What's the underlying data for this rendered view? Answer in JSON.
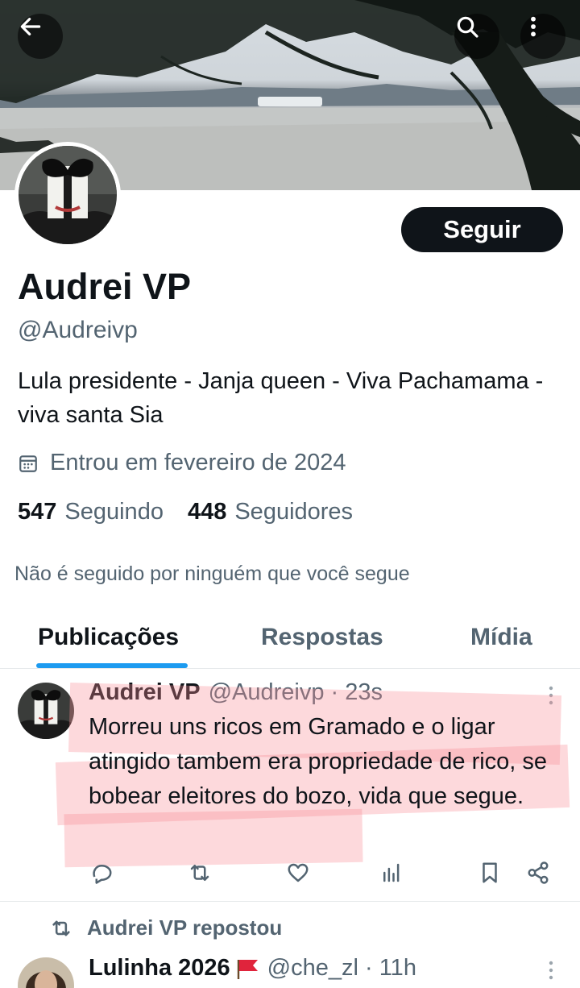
{
  "header": {
    "back_icon": "arrow-left-icon",
    "search_icon": "search-icon",
    "more_icon": "more-vertical-icon"
  },
  "profile": {
    "follow_label": "Seguir",
    "display_name": "Audrei VP",
    "handle": "@Audreivp",
    "bio": "Lula presidente - Janja queen - Viva Pachamama - viva santa Sia",
    "joined": "Entrou em fevereiro de 2024",
    "following_count": "547",
    "following_label": "Seguindo",
    "followers_count": "448",
    "followers_label": "Seguidores",
    "mutuals_note": "Não é seguido por ninguém que você segue"
  },
  "tabs": [
    {
      "label": "Publicações",
      "active": true
    },
    {
      "label": "Respostas",
      "active": false
    },
    {
      "label": "Mídia",
      "active": false
    }
  ],
  "posts": [
    {
      "name": "Audrei VP",
      "handle": "@Audreivp",
      "time": "23s",
      "meta": "@Audreivp · 23s",
      "text": "Morreu uns ricos em Gramado e o ligar atingido tambem era propriedade de rico, se bobear eleitores do bozo, vida que segue.",
      "actions": [
        "reply-icon",
        "repost-icon",
        "like-icon",
        "views-icon",
        "bookmark-icon",
        "share-icon"
      ]
    }
  ],
  "repost": {
    "label": "Audrei VP repostou",
    "name": "Lulinha 2026",
    "meta": "@che_zl · 11h"
  },
  "colors": {
    "accent": "#1d9bf0",
    "text_primary": "#0f1419",
    "text_secondary": "#536471",
    "button_dark": "#0f1419",
    "highlight": "#fa8c96"
  }
}
